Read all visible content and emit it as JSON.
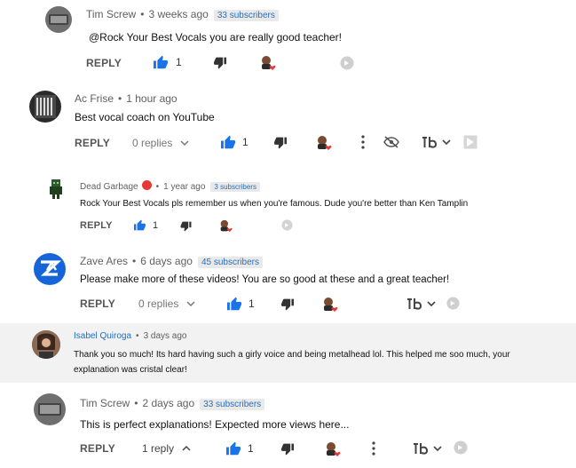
{
  "comments": [
    {
      "author": "Tim Screw",
      "time": "3 weeks ago",
      "subscribers": "33 subscribers",
      "text": "@Rock Your Best Vocals  you are really good teacher!",
      "reply_label": "REPLY",
      "likes": "1",
      "replies": ""
    },
    {
      "author": "Ac Frise",
      "time": "1 hour ago",
      "subscribers": "",
      "text": "Best vocal coach on YouTube",
      "reply_label": "REPLY",
      "likes": "1",
      "replies": "0 replies"
    },
    {
      "author": "Dead Garbage",
      "time": "1 year ago",
      "subscribers": "3 subscribers",
      "text": "Rock Your Best Vocals pls remember us when you're famous. Dude you're better than Ken Tamplin",
      "reply_label": "REPLY",
      "likes": "1",
      "replies": ""
    },
    {
      "author": "Zave Ares",
      "time": "6 days ago",
      "subscribers": "45 subscribers",
      "text": "Please make more of these videos! You are so good at these and a great teacher!",
      "reply_label": "REPLY",
      "likes": "1",
      "replies": "0 replies"
    },
    {
      "author": "Isabel Quiroga",
      "time": "3 days ago",
      "subscribers": "",
      "text_line1": "Thank you so much! Its hard having such a girly voice and being metalhead lol. This helped me soo much, your",
      "text_line2": "explanation was cristal clear!"
    },
    {
      "author": "Tim Screw",
      "time": "2 days ago",
      "subscribers": "33 subscribers",
      "text": "This is perfect explanations! Expected more views here...",
      "reply_label": "REPLY",
      "likes": "1",
      "replies": "1 reply"
    }
  ],
  "colors": {
    "like_blue": "#1a73e8",
    "author_link": "#1a6fc4",
    "badge_red": "#e53935"
  }
}
